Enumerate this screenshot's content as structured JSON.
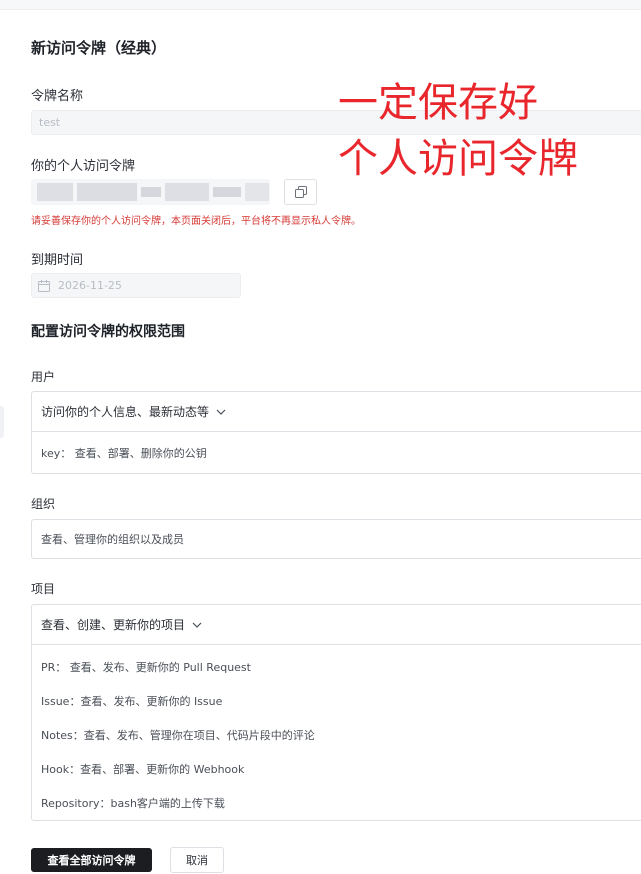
{
  "page": {
    "title": "新访问令牌（经典）"
  },
  "token_name": {
    "label": "令牌名称",
    "value": "test"
  },
  "personal_token": {
    "label": "你的个人访问令牌",
    "warning": "请妥善保存你的个人访问令牌，本页面关闭后，平台将不再显示私人令牌。"
  },
  "annotation": {
    "line1": "一定保存好",
    "line2": "个人访问令牌",
    "color": "#e8262b"
  },
  "expiry": {
    "label": "到期时间",
    "value": "2026-11-25"
  },
  "scope": {
    "title": "配置访问令牌的权限范围",
    "user": {
      "label": "用户",
      "head": "访问你的个人信息、最新动态等",
      "rows": [
        "key：  查看、部署、删除你的公钥"
      ]
    },
    "org": {
      "label": "组织",
      "head": "查看、管理你的组织以及成员"
    },
    "project": {
      "label": "项目",
      "head": "查看、创建、更新你的项目",
      "rows": [
        "PR：  查看、发布、更新你的 Pull Request",
        "Issue：查看、发布、更新你的 Issue",
        "Notes：查看、发布、管理你在项目、代码片段中的评论",
        "Hook：查看、部署、更新你的 Webhook",
        "Repository：bash客户端的上传下载"
      ]
    }
  },
  "actions": {
    "primary": "查看全部访问令牌",
    "cancel": "取消"
  },
  "icons": {
    "copy": "copy-icon",
    "calendar": "calendar-icon",
    "chevron": "chevron-down-icon"
  }
}
